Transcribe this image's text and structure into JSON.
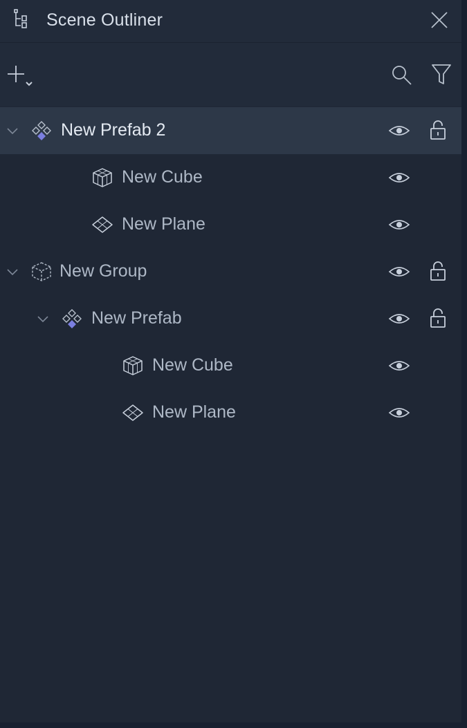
{
  "header": {
    "title": "Scene Outliner",
    "icons": {
      "outliner": "outliner-tree-icon",
      "close": "close-icon"
    }
  },
  "toolbar": {
    "icons": {
      "add": "plus-with-dropdown-icon",
      "search": "search-icon",
      "filter": "filter-icon"
    }
  },
  "colors": {
    "background": "#1f2735",
    "header": "#222b3a",
    "selected_row": "#2d3848",
    "text": "#aeb8c6",
    "accent_prefab": "#7b7fe0"
  },
  "tree": {
    "rows": [
      {
        "label": "New Prefab 2",
        "type": "prefab",
        "depth": 0,
        "expanded": true,
        "selected": true,
        "visible": true,
        "lockable": true
      },
      {
        "label": "New Cube",
        "type": "cube",
        "depth": 1,
        "visible": true,
        "lockable": false
      },
      {
        "label": "New Plane",
        "type": "plane",
        "depth": 1,
        "visible": true,
        "lockable": false
      },
      {
        "label": "New Group",
        "type": "group",
        "depth": 0,
        "expanded": true,
        "visible": true,
        "lockable": true
      },
      {
        "label": "New Prefab",
        "type": "prefab",
        "depth": 1,
        "expanded": true,
        "visible": true,
        "lockable": true
      },
      {
        "label": "New Cube",
        "type": "cube",
        "depth": 2,
        "visible": true,
        "lockable": false
      },
      {
        "label": "New Plane",
        "type": "plane",
        "depth": 2,
        "visible": true,
        "lockable": false
      }
    ]
  }
}
